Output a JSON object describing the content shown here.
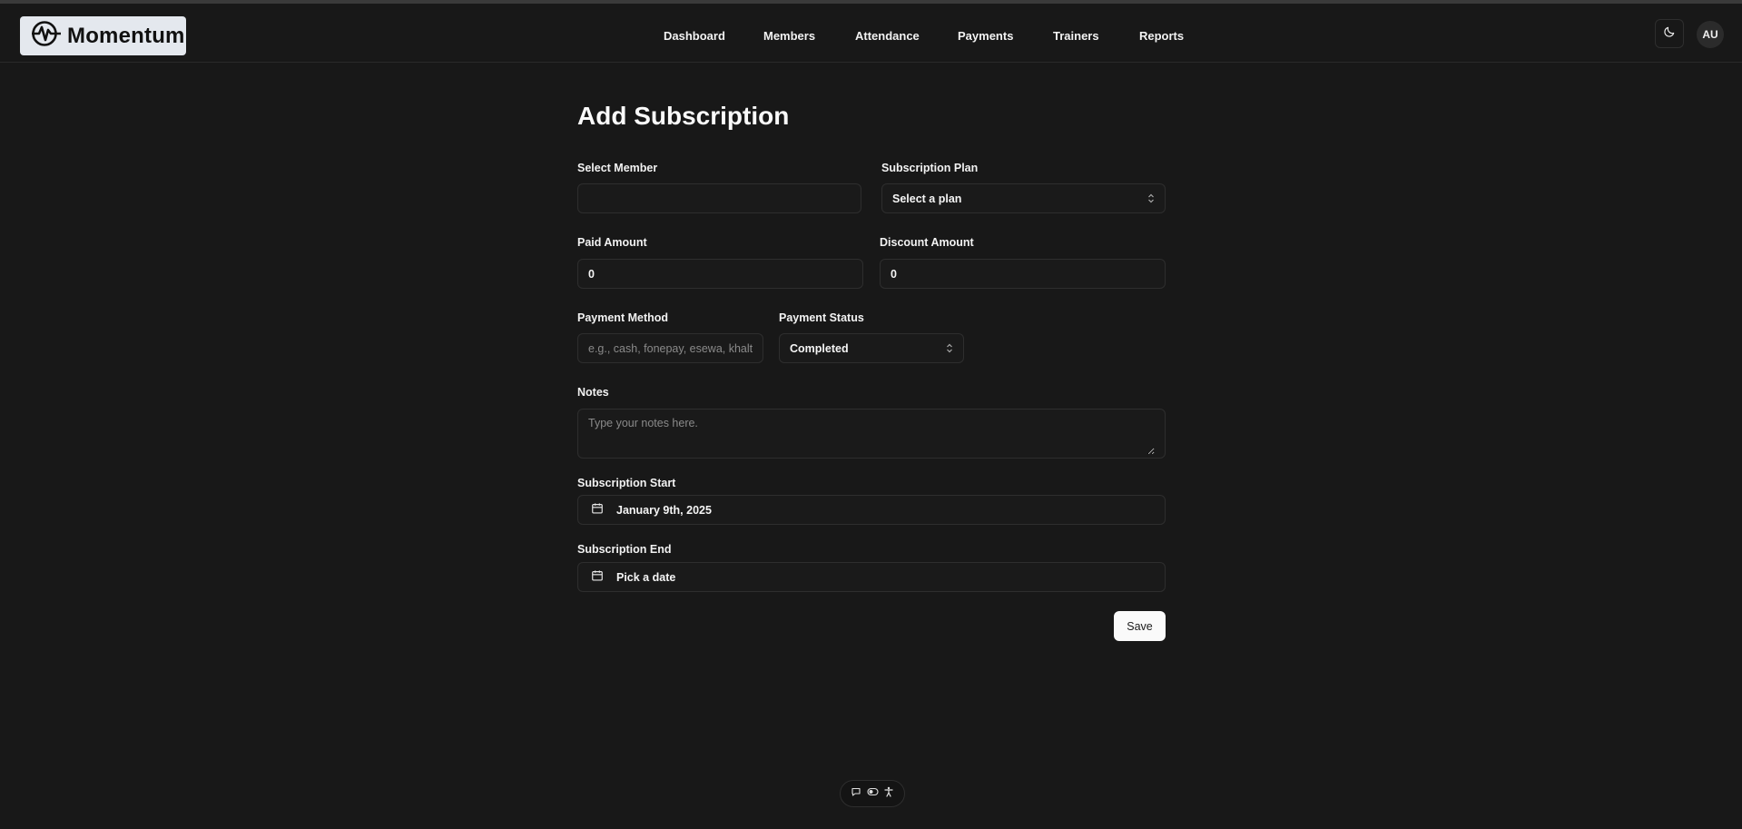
{
  "app": {
    "name": "Momentum"
  },
  "nav": {
    "dashboard": "Dashboard",
    "members": "Members",
    "attendance": "Attendance",
    "payments": "Payments",
    "trainers": "Trainers",
    "reports": "Reports"
  },
  "header": {
    "avatar_initials": "AU",
    "theme_icon": "moon-icon"
  },
  "form": {
    "title": "Add Subscription",
    "select_member": {
      "label": "Select Member",
      "value": ""
    },
    "subscription_plan": {
      "label": "Subscription Plan",
      "value": "Select a plan"
    },
    "paid_amount": {
      "label": "Paid Amount",
      "value": "0"
    },
    "discount_amount": {
      "label": "Discount Amount",
      "value": "0"
    },
    "payment_method": {
      "label": "Payment Method",
      "placeholder": "e.g., cash, fonepay, esewa, khalti",
      "value": ""
    },
    "payment_status": {
      "label": "Payment Status",
      "value": "Completed"
    },
    "notes": {
      "label": "Notes",
      "placeholder": "Type your notes here.",
      "value": ""
    },
    "subscription_start": {
      "label": "Subscription Start",
      "value": "January 9th, 2025"
    },
    "subscription_end": {
      "label": "Subscription End",
      "value": "Pick a date"
    },
    "save_label": "Save"
  },
  "toolbar": {
    "icons": [
      "chat-icon",
      "toggle-icon",
      "accessibility-icon"
    ]
  },
  "colors": {
    "background": "#181818",
    "border": "#2e2e2e",
    "accent": "#fafafa"
  }
}
